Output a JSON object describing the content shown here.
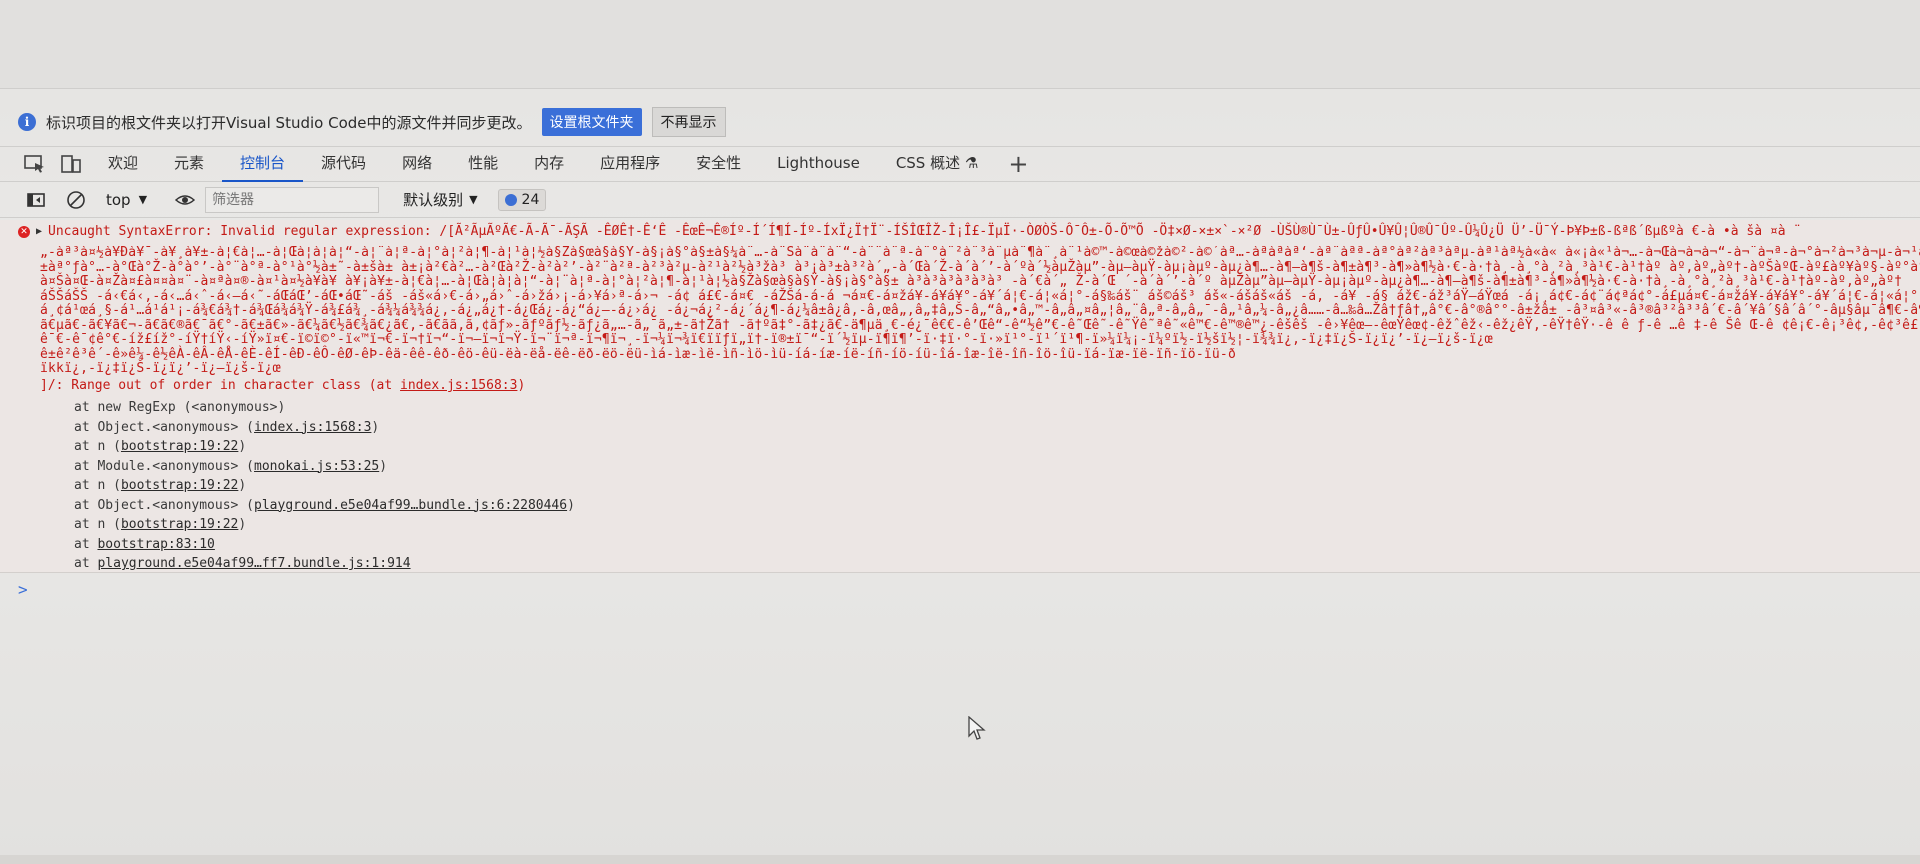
{
  "infobar": {
    "message": "标识项目的根文件夹以打开Visual Studio Code中的源文件并同步更改。",
    "primary_button": "设置根文件夹",
    "secondary_button": "不再显示"
  },
  "tabs": [
    {
      "label": "欢迎"
    },
    {
      "label": "元素"
    },
    {
      "label": "控制台",
      "active": true
    },
    {
      "label": "源代码"
    },
    {
      "label": "网络"
    },
    {
      "label": "性能"
    },
    {
      "label": "内存"
    },
    {
      "label": "应用程序"
    },
    {
      "label": "安全性"
    },
    {
      "label": "Lighthouse"
    },
    {
      "label": "CSS 概述 ⚗"
    }
  ],
  "toolbar": {
    "context": "top",
    "filter_placeholder": "筛选器",
    "level": "默认级别",
    "message_count": "24"
  },
  "console": {
    "error_title": "Uncaught SyntaxError: Invalid regular expression: /[Ã²ÃµÃºÃ€-Ã-Ã¯-ÃŞÃ -ÊØÊ†-Ê‘Ê -ÊœÊ¬Ê®Íº-Í´Í¶Í-Íº-ÍxÏ¿Ï†Ï¨-ÍŠÎŒÎŽ-Î¡Î£-ÏµÏ·-ÒØÒŠ-Ô¯Ô±-Õ-Õ™Õ -Ö‡×Ø-×±×`-×²Ø -ÙŠÙ®Ù¯Ù±-ÛƒÛ•Û¥Û¦Û®Û¯Ûº-Û¼Û¿Ü Ü’-Ü¯Ý-Þ¥Þ±ß-ßªß´ßµßºà €-à •à šà ¤à ¨",
    "garbled_lines": [
      "„-àª³à¤½à¥Ðà¥¯-à¥¸à¥±-à¦€à¦…-à¦Œà¦à¦à¦“-à¦¨à¦ª-à¦°à¦²à¦¶-à¦¹à¦½à§Žà§œà§à§Ÿ-à§¡à§°à§±à§¼à¨…-à¨Šà¨à¨à¨“-à¨¨à¨ª-à¨°à¨²à¨³à¨µà¨¶à¨¸à¨¹à©™-à©œà©žà©²-à©´àª…-àªàªàª‘-àª¨àªª-àª°àª²àª³àªµ-àª¹àª½à«à« à«¡à«¹à¬…-à¬Œà¬à¬à¬“-à¬¨à¬ª-à¬°à¬²à¬³à¬µ-à¬¹à¬½à­œà­à­Ÿ-à­¡à­±à®ƒà®…-à®Šà®Ž-à®à®’-à®•à®™à®šà®œà®žà®Ÿà®£à®¤à®¨-à®ªà®®-à®¹",
      "±àª°ƒà°…-à°Œà°Ž-à°à°’-à°¨à°ª-à°¹à°½à±˜-à±šà± à±¡à²€à²…-à²Œà²Ž-à²à²’-à²¨à²ª-à²³à²µ-à²¹à²½à³žà³ à³¡à³±à³²à´„-à´Œà´Ž-à´à´’-à´ºà´½àµŽàµ”-àµ–àµŸ-àµ¡àµº-àµ¿à¶…-à¶–à¶š-à¶±à¶³-à¶»à¶½à·€-à·†à¸-à¸°à¸²à¸³à¹€-à¹†àº àº‚àº„àº†-àºŠàºŒ-àº£àº¥àº§-àº°àº²àº³àº½à»€-à»„à»†à»œ-à»Ÿà¼€à½€-à½‡à½‰-à½¬à¾ˆ-à¾Œá€€-á€ªá€¿á",
      "à¤Šà¤Œ-à¤Žà¤£à¤¤à¤¨-à¤ªà¤®-à¤¹à¤½à¥à¥ à¥¡à¥±-à¦€à¦…-à¦Œà¦à¦à¦“-à¦¨à¦ª-à¦°à¦²à¦¶-à¦¹à¦½à§Žà§œà§à§Ÿ-à§¡à§°à§± à³à³à³à³à³à³ -à´€à´„ Ž-à´Œ ´-à´à´’-à´º àµŽàµ”àµ–àµŸ-àµ¡àµº-àµ¿à¶…-à¶–à¶š-à¶±à¶³-à¶»à¶½à·€-à·†à¸-à¸°à¸²à¸³à¹€-à¹†àº-àº‚àº„àº†",
      "áŠŠáŠŠ -á‹€á‹‚-á‹…á‹ˆ-á‹–á‹˜-áŒáŒ’-áŒ•áŒ˜-áš -áš«á›€-á›„á›ˆ-á›žá›¡-á›¥á›ª-á›¬ -á¢ á£€-á¤€ -áŽŠá-á-á ¬á¤€-á¤žá¥-á¥­á¥°-á¥´á¦€-á¦«á¦°-á§‰áš¨ áš©áš³ áš«-áš­áš«áš­ -á‚ -á¥ -á§ áž€-áž³áŸ—áŸœá  -á¡¸á¢€-á¢¨á¢ªá¢°-á£µá¤€-á¤žá¥-á¥­á¥°-á¥´á¦€-á¦«á¦°-á§‰á¨€-á¨–á¨ -á©”áª§á¬…-á¬³á­…-á­‹á®ƒ-á® á®®á®¯á®º-á¯¥á°€-á°£á±",
      "á¸¢á¹œá¸§-á¹…á¹á¹¡-á¾€á¾†-á¾Œá¾á¾Ÿ-á¾£á¾¸-á¾¼á¾¾á¿‚-á¿„á¿†-á¿Œá¿-á¿“á¿–-á¿›á¿ -á¿¬á¿²-á¿´á¿¶-á¿¼â±â¿â‚-â‚œâ„‚â„‡â„Š-â„“â„•â„™-â„â„¤â„¦â„¨â„ª-â„­â„¯-â„¹â„¼-â„¿â……-â…‰â…Žâ†ƒâ†„â°€-â°®â°°-â±žâ± -â³¤â³«-â³®â³²â³³â´€-â´¥â´§â´­â´°-âµ§âµ¯â¶€-â¶–â¶ -â¶¦â¶¨-â¶®â¶°-â¶¶â¶¸-â¶¾â·€-â·†â·ˆ-â·Žâ·-â·–â·˜-â·žã€…ã€†ã€±-ã€µã€»ã€¼",
      "ã€µã€-ã€¥ã€¬-ã€­ã€®ã€¯ã€°-ã€±ã€»-ã€¼ã€½ã€¾ã€¿ã€‚-ã€ãã‚ã‚¢ãƒ»-ãƒºãƒ½-ãƒ¿ã„…-ã„¯ã„±-ã†Žã† -ã†ºã‡°-ã‡¿ã€-ä¶µä¸€-é¿¯ê€€-ê’Œê“-ê“½ê”€-ê˜Œê˜-ê˜Ÿê˜ªê˜«ê™€-ê™®ê™¿-êšêš -ê›¥êœ—-êœŸêœ¢-êžˆêž‹-êž¿êŸ‚-êŸ†êŸ·-ê ê ƒ-ê …ê ‡-ê Šê Œ-ê ¢ê¡€-ê¡³ê¢‚-ê¢³ê£²-ê£·ê£»ê£½ê£¾ê¤Š-ê¤¥ê¤°-ê¥†ê¥ -ê¥¼ê¦„-ê¦²ê§ê§ -ê§¤ê§¦-ê§¯ê§º-ê§¾ê¨€-ê¨¨ê©€-ê©‚ê©„-ê©‹ê© -ê©¶ê©ºê©¾-êª¯",
      "ê¯€-ê¯¢ê°€-íž£íž°-íŸ†íŸ‹-íŸ»ï¤€-ï©­ï©°-ï«™ï¬€-ï¬†ï¬“-ï¬—ï¬ï¬Ÿ-ï¬¨ï¬ª-ï¬¶ï¬¸-ï¬¼ï¬¾ï­€ï­ï­ƒï­„ï­†-ï®±ï¯“-ï´½ïµ-ï¶ï¶’-ï·‡ï·°-ï·»ï¹°-ï¹´ï¹¶-ï»¼ï¼¡-ï¼ºï½-ï½šï½¦-ï¾¾ï¿‚-ï¿‡ï¿Š-ï¿ï¿’-ï¿—ï¿š-ï¿œ",
      "ê±ê²ê³ê´-ê»ê¼-ê½êÀ-êÂ-êÅ-êÈ-êÍ-êÐ-êÔ-êØ-êÞ-êä-êê-êð-êö-êü-ëà-ëå-ëê-ëð-ëö-ëü-ìá-ìæ-ìë-ìñ-ìö-ìü-íá-íæ-íë-íñ-íö-íü-îá-îæ-îë-îñ-îö-îü-ïá-ïæ-ïë-ïñ-ïö-ïü-ð",
      "ïkkï¿,-ï¿‡ï¿Š-ï¿ï¿’-ï¿—ï¿š-ï¿œ"
    ],
    "range_prefix": "]/: Range out of order in character class (at ",
    "range_link": "index.js:1568:3",
    "range_suffix": ")",
    "stack": [
      {
        "prefix": "at new RegExp (<anonymous>)",
        "link": "",
        "suffix": ""
      },
      {
        "prefix": "at Object.<anonymous> (",
        "link": "index.js:1568:3",
        "suffix": ")"
      },
      {
        "prefix": "at n (",
        "link": "bootstrap:19:22",
        "suffix": ")"
      },
      {
        "prefix": "at Module.<anonymous> (",
        "link": "monokai.js:53:25",
        "suffix": ")"
      },
      {
        "prefix": "at n (",
        "link": "bootstrap:19:22",
        "suffix": ")"
      },
      {
        "prefix": "at Object.<anonymous> (",
        "link": "playground.e5e04af99…bundle.js:6:2280446",
        "suffix": ")"
      },
      {
        "prefix": "at n (",
        "link": "bootstrap:19:22",
        "suffix": ")"
      },
      {
        "prefix": "at ",
        "link": "bootstrap:83:10",
        "suffix": ""
      },
      {
        "prefix": "at ",
        "link": "playground.e5e04af99…ff7.bundle.js:1:914",
        "suffix": ""
      }
    ],
    "prompt": ">"
  },
  "colors": {
    "accent": "#1a56c8",
    "error_text": "#c41a16",
    "info_icon": "#3c6fd4"
  },
  "icons": [
    "info-icon",
    "inspect-icon",
    "device-toggle-icon",
    "sidebar-toggle-icon",
    "clear-icon",
    "eye-icon",
    "error-icon",
    "expand-triangle-icon",
    "plus-icon",
    "mouse-pointer-icon"
  ]
}
